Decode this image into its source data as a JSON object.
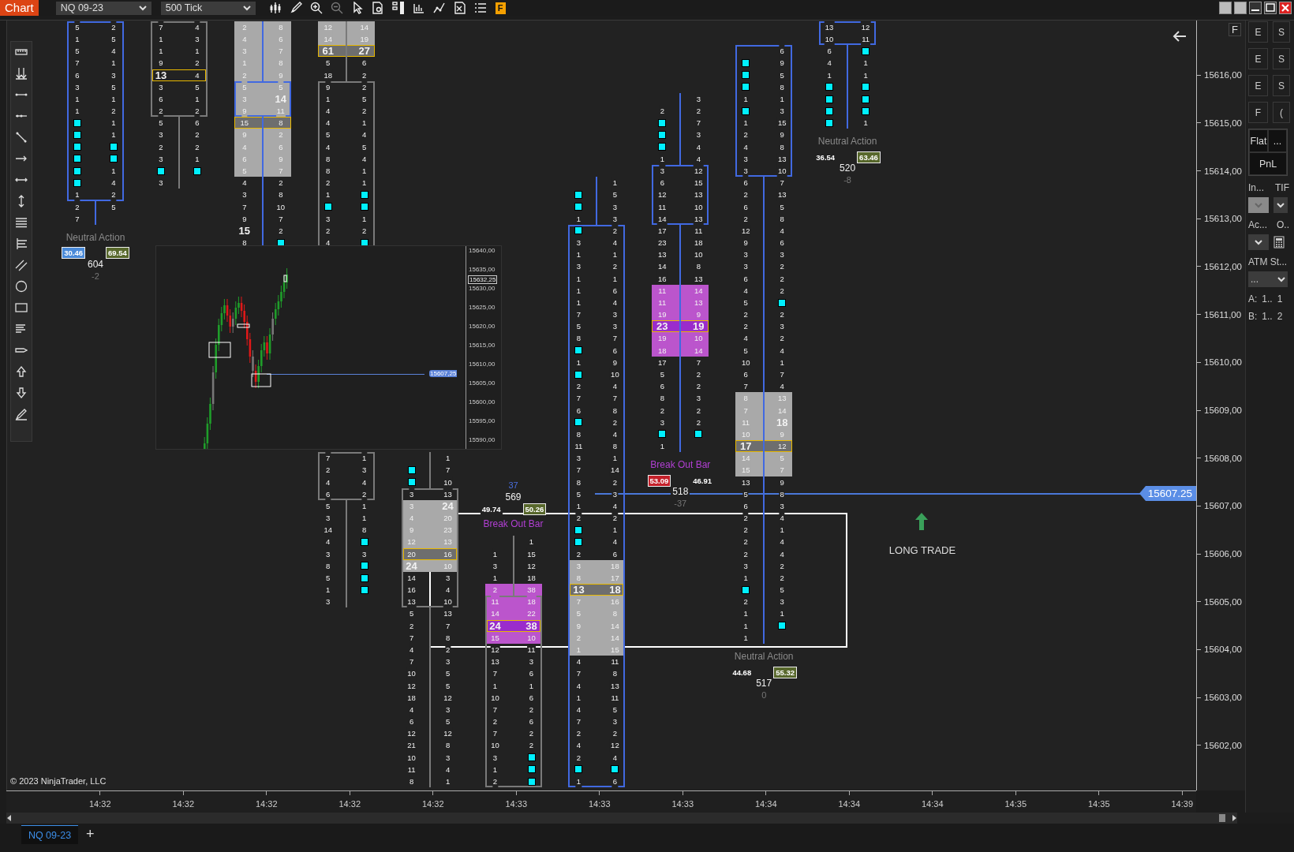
{
  "toolbar": {
    "title": "Chart",
    "instrument": "NQ 09-23",
    "interval": "500 Tick",
    "f_button": "F"
  },
  "chart": {
    "bars": [
      {
        "rising": true,
        "rows": [
          {
            "cells": [
              "5",
              "2"
            ],
            "boxed": true
          },
          {
            "cells": [
              "1",
              "5"
            ],
            "boxed": true
          },
          {
            "cells": [
              "5",
              "4"
            ],
            "boxed": true
          },
          {
            "cells": [
              "7",
              "1"
            ],
            "boxed": true
          },
          {
            "cells": [
              "6",
              "3"
            ],
            "boxed": true
          },
          {
            "cells": [
              "3",
              "5"
            ],
            "boxed": true
          },
          {
            "cells": [
              "1",
              "1"
            ],
            "boxed": true
          },
          {
            "cells": [
              "1",
              "2"
            ],
            "boxed": true
          },
          {
            "cells": [
              {
                "kind": "marker"
              },
              "1"
            ],
            "boxed": true
          },
          {
            "cells": [
              {
                "kind": "marker"
              },
              "1"
            ],
            "boxed": true
          },
          {
            "cells": [
              {
                "kind": "marker"
              },
              {
                "kind": "marker"
              }
            ],
            "boxed": true
          },
          {
            "cells": [
              {
                "kind": "marker"
              },
              {
                "kind": "marker"
              }
            ],
            "boxed": true
          },
          {
            "cells": [
              {
                "kind": "marker"
              },
              "1"
            ],
            "boxed": true
          },
          {
            "cells": [
              {
                "kind": "marker"
              },
              "4"
            ],
            "boxed": true
          },
          {
            "cells": [
              "1",
              "2"
            ],
            "boxed": true
          },
          [
            "2",
            "5"
          ],
          [
            "7",
            null
          ]
        ],
        "summary": {
          "above": false,
          "label": {
            "text": "Neutral Action",
            "breakout": false
          },
          "sell": {
            "text": "30.46",
            "color": "#4a8ad8"
          },
          "buy": {
            "text": "69.54",
            "color": "#58682c"
          },
          "volume": "604",
          "delta": {
            "text": "-2",
            "positive": false
          }
        }
      },
      {
        "rising": false,
        "rows": [
          {
            "cells": [
              "7",
              "4"
            ],
            "boxed": true
          },
          {
            "cells": [
              "1",
              "3"
            ],
            "boxed": true
          },
          {
            "cells": [
              "1",
              "1"
            ],
            "boxed": true
          },
          {
            "cells": [
              "9",
              "2"
            ],
            "boxed": true
          },
          {
            "cells": [
              {
                "text": "13",
                "bold": true
              },
              "4"
            ],
            "boxed": true,
            "gold": true
          },
          {
            "cells": [
              "3",
              "5"
            ],
            "boxed": true
          },
          {
            "cells": [
              "6",
              "1"
            ],
            "boxed": true
          },
          {
            "cells": [
              "2",
              "2"
            ],
            "boxed": true
          },
          [
            "5",
            "6"
          ],
          [
            "3",
            "2"
          ],
          [
            "2",
            "2"
          ],
          [
            "3",
            "1"
          ],
          [
            {
              "kind": "marker"
            },
            {
              "kind": "marker"
            }
          ],
          [
            "3",
            null
          ]
        ]
      },
      {
        "rising": true,
        "rows": [
          {
            "cells": [
              "2",
              "8"
            ],
            "color": "#a9a9a9"
          },
          {
            "cells": [
              "4",
              "6"
            ],
            "color": "#a9a9a9"
          },
          {
            "cells": [
              "3",
              "7"
            ],
            "color": "#a9a9a9"
          },
          {
            "cells": [
              "1",
              "8"
            ],
            "color": "#a9a9a9"
          },
          {
            "cells": [
              "2",
              "9"
            ],
            "color": "#a9a9a9"
          },
          {
            "cells": [
              "5",
              "5"
            ],
            "color": "#a9a9a9",
            "boxed": true
          },
          {
            "cells": [
              "3",
              {
                "text": "14",
                "bold": true
              }
            ],
            "color": "#a9a9a9",
            "boxed": true
          },
          {
            "cells": [
              "9",
              "11"
            ],
            "color": "#a9a9a9",
            "boxed": true
          },
          {
            "cells": [
              "15",
              "8"
            ],
            "color": "#6e6e6e",
            "gold": true
          },
          {
            "cells": [
              "9",
              "2"
            ],
            "color": "#a9a9a9"
          },
          {
            "cells": [
              "4",
              "6"
            ],
            "color": "#a9a9a9"
          },
          {
            "cells": [
              "6",
              "9"
            ],
            "color": "#a9a9a9"
          },
          {
            "cells": [
              "5",
              "7"
            ],
            "color": "#a9a9a9"
          },
          [
            "4",
            "2"
          ],
          [
            "3",
            "8"
          ],
          [
            "7",
            "10"
          ],
          [
            "9",
            "7"
          ],
          [
            {
              "text": "15",
              "bold": true
            },
            "2"
          ],
          [
            "8",
            {
              "kind": "marker"
            }
          ]
        ]
      },
      {
        "rising": false,
        "rows": [
          {
            "cells": [
              "12",
              "14"
            ],
            "color": "#a9a9a9"
          },
          {
            "cells": [
              "14",
              "19"
            ],
            "color": "#a9a9a9"
          },
          {
            "cells": [
              {
                "text": "61",
                "bold": true
              },
              {
                "text": "27",
                "bold": true
              }
            ],
            "color": "#6e6e6e",
            "gold": true
          },
          [
            "5",
            "6"
          ],
          [
            "18",
            "2"
          ],
          {
            "cells": [
              "9",
              "2"
            ],
            "boxed": true
          },
          {
            "cells": [
              "1",
              "5"
            ],
            "boxed": true
          },
          {
            "cells": [
              "4",
              "2"
            ],
            "boxed": true
          },
          {
            "cells": [
              "4",
              "1"
            ],
            "boxed": true
          },
          {
            "cells": [
              "5",
              "4"
            ],
            "boxed": true
          },
          {
            "cells": [
              "4",
              "5"
            ],
            "boxed": true
          },
          {
            "cells": [
              "8",
              "4"
            ],
            "boxed": true
          },
          {
            "cells": [
              "8",
              "1"
            ],
            "boxed": true
          },
          {
            "cells": [
              "2",
              "1"
            ],
            "boxed": true
          },
          {
            "cells": [
              "1",
              {
                "kind": "marker"
              }
            ],
            "boxed": true
          },
          {
            "cells": [
              {
                "kind": "marker"
              },
              {
                "kind": "marker"
              }
            ],
            "boxed": true
          },
          {
            "cells": [
              "3",
              "1"
            ],
            "boxed": true
          },
          {
            "cells": [
              "2",
              "2"
            ],
            "boxed": true
          },
          {
            "cells": [
              "4",
              {
                "kind": "marker"
              }
            ],
            "boxed": true
          },
          null,
          null,
          null,
          null,
          null,
          null,
          null,
          null,
          null,
          null,
          null,
          null,
          null,
          null,
          null,
          null,
          null,
          {
            "cells": [
              "7",
              "1"
            ],
            "boxed": true
          },
          {
            "cells": [
              "2",
              "3"
            ],
            "boxed": true
          },
          {
            "cells": [
              "4",
              "4"
            ],
            "boxed": true
          },
          {
            "cells": [
              "6",
              "2"
            ],
            "boxed": true
          },
          [
            "5",
            "1"
          ],
          [
            "3",
            "1"
          ],
          [
            "14",
            "8"
          ],
          [
            "4",
            {
              "kind": "marker"
            }
          ],
          [
            "3",
            "3"
          ],
          [
            "8",
            {
              "kind": "marker"
            }
          ],
          [
            "5",
            {
              "kind": "marker"
            }
          ],
          [
            "1",
            {
              "kind": "marker"
            }
          ],
          [
            "3",
            null
          ]
        ]
      },
      {
        "rising": false,
        "rows": [
          null,
          null,
          null,
          null,
          null,
          null,
          null,
          null,
          null,
          null,
          null,
          null,
          null,
          null,
          null,
          null,
          null,
          null,
          null,
          null,
          null,
          null,
          null,
          null,
          null,
          null,
          null,
          null,
          null,
          null,
          null,
          null,
          null,
          null,
          null,
          null,
          [
            null,
            "1"
          ],
          [
            {
              "kind": "marker"
            },
            "7"
          ],
          [
            {
              "kind": "marker"
            },
            "10"
          ],
          {
            "cells": [
              "3",
              "13"
            ],
            "boxed": true
          },
          {
            "cells": [
              "3",
              {
                "text": "24",
                "bold": true
              }
            ],
            "boxed": true,
            "color": "#a9a9a9"
          },
          {
            "cells": [
              "4",
              "20"
            ],
            "boxed": true,
            "color": "#a9a9a9"
          },
          {
            "cells": [
              "9",
              "23"
            ],
            "boxed": true,
            "color": "#a9a9a9"
          },
          {
            "cells": [
              "12",
              "13"
            ],
            "boxed": true,
            "color": "#a9a9a9"
          },
          {
            "cells": [
              "20",
              "16"
            ],
            "boxed": true,
            "color": "#6e6e6e",
            "gold": true
          },
          {
            "cells": [
              {
                "text": "24",
                "bold": true
              },
              "10"
            ],
            "boxed": true,
            "color": "#a9a9a9"
          },
          {
            "cells": [
              "14",
              "3"
            ],
            "boxed": true
          },
          {
            "cells": [
              "16",
              "4"
            ],
            "boxed": true
          },
          {
            "cells": [
              "13",
              "10"
            ],
            "boxed": true
          },
          [
            "5",
            "13"
          ],
          [
            "2",
            "7"
          ],
          [
            "7",
            "8"
          ],
          [
            "4",
            "2"
          ],
          [
            "7",
            "3"
          ],
          [
            "10",
            "5"
          ],
          [
            "12",
            "5"
          ],
          [
            "18",
            "12"
          ],
          [
            "4",
            "3"
          ],
          [
            "6",
            "5"
          ],
          [
            "12",
            "12"
          ],
          [
            "21",
            "8"
          ],
          [
            "10",
            "3"
          ],
          [
            "11",
            "4"
          ],
          [
            "8",
            "1"
          ]
        ]
      },
      {
        "rising": false,
        "rows": [
          null,
          null,
          null,
          null,
          null,
          null,
          null,
          null,
          null,
          null,
          null,
          null,
          null,
          null,
          null,
          null,
          null,
          null,
          null,
          null,
          null,
          null,
          null,
          null,
          null,
          null,
          null,
          null,
          null,
          null,
          null,
          null,
          null,
          null,
          null,
          null,
          null,
          null,
          null,
          null,
          null,
          null,
          null,
          [
            null,
            "1"
          ],
          [
            "1",
            "15"
          ],
          [
            "3",
            "12"
          ],
          [
            "1",
            "18"
          ],
          {
            "cells": [
              "2",
              "38"
            ],
            "color": "#bb55cc"
          },
          {
            "cells": [
              "11",
              "18"
            ],
            "color": "#bb55cc",
            "boxed": true
          },
          {
            "cells": [
              "14",
              "22"
            ],
            "color": "#bb55cc",
            "boxed": true
          },
          {
            "cells": [
              {
                "text": "24",
                "bold": true
              },
              {
                "text": "38",
                "bold": true
              }
            ],
            "color": "#9a2ccc",
            "boxed": true,
            "gold": true
          },
          {
            "cells": [
              "15",
              "10"
            ],
            "color": "#bb55cc",
            "boxed": true
          },
          {
            "cells": [
              "12",
              "11"
            ],
            "boxed": true
          },
          {
            "cells": [
              "13",
              "3"
            ],
            "boxed": true
          },
          {
            "cells": [
              "7",
              "6"
            ],
            "boxed": true
          },
          {
            "cells": [
              "1",
              "1"
            ],
            "boxed": true
          },
          {
            "cells": [
              "10",
              "6"
            ],
            "boxed": true
          },
          {
            "cells": [
              "7",
              "2"
            ],
            "boxed": true
          },
          {
            "cells": [
              "2",
              "6"
            ],
            "boxed": true
          },
          {
            "cells": [
              "7",
              "2"
            ],
            "boxed": true
          },
          {
            "cells": [
              "10",
              "2"
            ],
            "boxed": true
          },
          {
            "cells": [
              "3",
              {
                "kind": "marker"
              }
            ],
            "boxed": true
          },
          {
            "cells": [
              "1",
              {
                "kind": "marker"
              }
            ],
            "boxed": true
          },
          {
            "cells": [
              "2",
              {
                "kind": "marker"
              }
            ],
            "boxed": true
          }
        ],
        "summary": {
          "above": true,
          "label": {
            "text": "Break Out Bar",
            "breakout": true
          },
          "sell": {
            "text": "49.74"
          },
          "buy": {
            "text": "50.26",
            "color": "#58682c"
          },
          "volume": "569",
          "delta": {
            "text": "37",
            "positive": true
          }
        }
      },
      {
        "rising": true,
        "rows": [
          null,
          null,
          null,
          null,
          null,
          null,
          null,
          null,
          null,
          null,
          null,
          null,
          null,
          [
            null,
            "1"
          ],
          [
            {
              "kind": "marker"
            },
            "5"
          ],
          [
            {
              "kind": "marker"
            },
            "3"
          ],
          [
            "1",
            "3"
          ],
          {
            "cells": [
              {
                "kind": "marker"
              },
              "2"
            ],
            "boxed": true
          },
          {
            "cells": [
              "3",
              "4"
            ],
            "boxed": true
          },
          {
            "cells": [
              "1",
              "1"
            ],
            "boxed": true
          },
          {
            "cells": [
              "3",
              "2"
            ],
            "boxed": true
          },
          {
            "cells": [
              "1",
              "1"
            ],
            "boxed": true
          },
          {
            "cells": [
              "1",
              "6"
            ],
            "boxed": true
          },
          {
            "cells": [
              "1",
              "4"
            ],
            "boxed": true
          },
          {
            "cells": [
              "7",
              "3"
            ],
            "boxed": true
          },
          {
            "cells": [
              "5",
              "3"
            ],
            "boxed": true
          },
          {
            "cells": [
              "8",
              "7"
            ],
            "boxed": true
          },
          {
            "cells": [
              {
                "kind": "marker"
              },
              "6"
            ],
            "boxed": true
          },
          {
            "cells": [
              "1",
              "9"
            ],
            "boxed": true
          },
          {
            "cells": [
              {
                "kind": "marker"
              },
              "10"
            ],
            "boxed": true
          },
          {
            "cells": [
              "2",
              "4"
            ],
            "boxed": true
          },
          {
            "cells": [
              "7",
              "7"
            ],
            "boxed": true
          },
          {
            "cells": [
              "6",
              "8"
            ],
            "boxed": true
          },
          {
            "cells": [
              {
                "kind": "marker"
              },
              "2"
            ],
            "boxed": true
          },
          {
            "cells": [
              "8",
              "4"
            ],
            "boxed": true
          },
          {
            "cells": [
              "11",
              "8"
            ],
            "boxed": true
          },
          {
            "cells": [
              "3",
              "1"
            ],
            "boxed": true
          },
          {
            "cells": [
              "7",
              "14"
            ],
            "boxed": true
          },
          {
            "cells": [
              "8",
              "2"
            ],
            "boxed": true
          },
          {
            "cells": [
              "5",
              "3"
            ],
            "boxed": true
          },
          {
            "cells": [
              "1",
              "4"
            ],
            "boxed": true
          },
          {
            "cells": [
              "2",
              "2"
            ],
            "boxed": true
          },
          {
            "cells": [
              {
                "kind": "marker"
              },
              "1"
            ],
            "boxed": true
          },
          {
            "cells": [
              {
                "kind": "marker"
              },
              "4"
            ],
            "boxed": true
          },
          {
            "cells": [
              "2",
              "6"
            ],
            "boxed": true
          },
          {
            "cells": [
              "3",
              "18"
            ],
            "boxed": true,
            "color": "#a9a9a9"
          },
          {
            "cells": [
              "8",
              "17"
            ],
            "boxed": true,
            "color": "#a9a9a9"
          },
          {
            "cells": [
              {
                "text": "13",
                "bold": true
              },
              {
                "text": "18",
                "bold": true
              }
            ],
            "boxed": true,
            "color": "#6e6e6e",
            "gold": true
          },
          {
            "cells": [
              "7",
              "16"
            ],
            "boxed": true,
            "color": "#a9a9a9"
          },
          {
            "cells": [
              "5",
              "8"
            ],
            "boxed": true,
            "color": "#a9a9a9"
          },
          {
            "cells": [
              "9",
              "14"
            ],
            "boxed": true,
            "color": "#a9a9a9"
          },
          {
            "cells": [
              "2",
              "14"
            ],
            "boxed": true,
            "color": "#a9a9a9"
          },
          {
            "cells": [
              "1",
              "15"
            ],
            "boxed": true,
            "color": "#a9a9a9"
          },
          {
            "cells": [
              "4",
              "11"
            ],
            "boxed": true
          },
          {
            "cells": [
              "7",
              "8"
            ],
            "boxed": true
          },
          {
            "cells": [
              "4",
              "13"
            ],
            "boxed": true
          },
          {
            "cells": [
              "1",
              "11"
            ],
            "boxed": true
          },
          {
            "cells": [
              "4",
              "5"
            ],
            "boxed": true
          },
          {
            "cells": [
              "7",
              "3"
            ],
            "boxed": true
          },
          {
            "cells": [
              "2",
              "2"
            ],
            "boxed": true
          },
          {
            "cells": [
              "4",
              "12"
            ],
            "boxed": true
          },
          {
            "cells": [
              "2",
              "4"
            ],
            "boxed": true
          },
          {
            "cells": [
              {
                "kind": "marker"
              },
              {
                "kind": "marker"
              }
            ],
            "boxed": true
          },
          {
            "cells": [
              "1",
              "6"
            ],
            "boxed": true
          }
        ]
      },
      {
        "rising": true,
        "rows": [
          null,
          null,
          null,
          null,
          null,
          null,
          [
            null,
            "3"
          ],
          [
            "2",
            "2"
          ],
          [
            {
              "kind": "marker"
            },
            "7"
          ],
          [
            {
              "kind": "marker"
            },
            "3"
          ],
          [
            {
              "kind": "marker"
            },
            "4"
          ],
          [
            "1",
            "4"
          ],
          {
            "cells": [
              "3",
              "12"
            ],
            "boxed": true
          },
          {
            "cells": [
              "6",
              "15"
            ],
            "boxed": true
          },
          {
            "cells": [
              "12",
              "13"
            ],
            "boxed": true
          },
          {
            "cells": [
              "11",
              "10"
            ],
            "boxed": true
          },
          {
            "cells": [
              "14",
              "13"
            ],
            "boxed": true
          },
          [
            "17",
            "11"
          ],
          [
            "23",
            "18"
          ],
          [
            "13",
            "10"
          ],
          [
            "14",
            "8"
          ],
          [
            "16",
            "13"
          ],
          {
            "cells": [
              "11",
              "14"
            ],
            "color": "#bb55cc"
          },
          {
            "cells": [
              "11",
              "13"
            ],
            "color": "#bb55cc"
          },
          {
            "cells": [
              "19",
              "9"
            ],
            "color": "#bb55cc"
          },
          {
            "cells": [
              {
                "text": "23",
                "bold": true
              },
              {
                "text": "19",
                "bold": true
              }
            ],
            "color": "#9a2ccc",
            "gold": true
          },
          {
            "cells": [
              "19",
              "10"
            ],
            "color": "#bb55cc"
          },
          {
            "cells": [
              "18",
              "14"
            ],
            "color": "#bb55cc"
          },
          [
            "17",
            "7"
          ],
          [
            "5",
            "2"
          ],
          [
            "6",
            "2"
          ],
          [
            "8",
            "3"
          ],
          [
            "2",
            "2"
          ],
          [
            "3",
            "2"
          ],
          [
            {
              "kind": "marker"
            },
            {
              "kind": "marker"
            }
          ],
          [
            "1",
            null
          ]
        ],
        "summary": {
          "above": false,
          "label": {
            "text": "Break Out Bar",
            "breakout": true
          },
          "sell": {
            "text": "53.09",
            "color": "#c4202a"
          },
          "buy": {
            "text": "46.91"
          },
          "volume": "518",
          "delta": {
            "text": "-37",
            "positive": false
          }
        }
      },
      {
        "rising": true,
        "rows": [
          null,
          null,
          {
            "cells": [
              null,
              "6"
            ],
            "boxed": true
          },
          {
            "cells": [
              {
                "kind": "marker"
              },
              "9"
            ],
            "boxed": true
          },
          {
            "cells": [
              {
                "kind": "marker"
              },
              "5"
            ],
            "boxed": true
          },
          {
            "cells": [
              {
                "kind": "marker"
              },
              "8"
            ],
            "boxed": true
          },
          {
            "cells": [
              "1",
              "1"
            ],
            "boxed": true
          },
          {
            "cells": [
              {
                "kind": "marker"
              },
              "3"
            ],
            "boxed": true
          },
          {
            "cells": [
              "1",
              "15"
            ],
            "boxed": true
          },
          {
            "cells": [
              "2",
              "9"
            ],
            "boxed": true
          },
          {
            "cells": [
              "4",
              "8"
            ],
            "boxed": true
          },
          {
            "cells": [
              "3",
              "13"
            ],
            "boxed": true
          },
          {
            "cells": [
              "3",
              "10"
            ],
            "boxed": true
          },
          [
            "6",
            "7"
          ],
          [
            "2",
            "13"
          ],
          [
            "6",
            "5"
          ],
          [
            "2",
            "8"
          ],
          [
            "12",
            "4"
          ],
          [
            "9",
            "6"
          ],
          [
            "3",
            "3"
          ],
          [
            "3",
            "2"
          ],
          [
            "6",
            "2"
          ],
          [
            "4",
            "2"
          ],
          [
            "5",
            {
              "kind": "marker"
            }
          ],
          [
            "2",
            "2"
          ],
          [
            "2",
            "3"
          ],
          [
            "4",
            "2"
          ],
          [
            "5",
            "4"
          ],
          [
            "10",
            "1"
          ],
          [
            "6",
            "7"
          ],
          [
            "7",
            "4"
          ],
          {
            "cells": [
              "8",
              "13"
            ],
            "color": "#a9a9a9"
          },
          {
            "cells": [
              "7",
              "14"
            ],
            "color": "#a9a9a9"
          },
          {
            "cells": [
              "11",
              {
                "text": "18",
                "bold": true
              }
            ],
            "color": "#a9a9a9"
          },
          {
            "cells": [
              "10",
              "9"
            ],
            "color": "#a9a9a9"
          },
          {
            "cells": [
              {
                "text": "17",
                "bold": true
              },
              "12"
            ],
            "color": "#6e6e6e",
            "gold": true
          },
          {
            "cells": [
              "14",
              "5"
            ],
            "color": "#a9a9a9"
          },
          {
            "cells": [
              "15",
              "7"
            ],
            "color": "#a9a9a9"
          },
          [
            "13",
            "9"
          ],
          [
            "5",
            "8"
          ],
          [
            "6",
            "3"
          ],
          [
            "2",
            "4"
          ],
          [
            "2",
            "1"
          ],
          [
            "2",
            "4"
          ],
          [
            "2",
            "4"
          ],
          [
            "3",
            "2"
          ],
          [
            "1",
            "2"
          ],
          [
            {
              "kind": "marker"
            },
            "5"
          ],
          [
            "2",
            "3"
          ],
          [
            "1",
            "1"
          ],
          [
            "1",
            {
              "kind": "marker"
            }
          ],
          [
            "1",
            null
          ]
        ],
        "summary": {
          "above": false,
          "label": {
            "text": "Neutral Action",
            "breakout": false
          },
          "sell": {
            "text": "44.68"
          },
          "buy": {
            "text": "55.32",
            "color": "#58682c"
          },
          "volume": "517",
          "delta": {
            "text": "0",
            "positive": false
          }
        }
      },
      {
        "rising": true,
        "rows": [
          {
            "cells": [
              "13",
              "12"
            ],
            "boxed": true
          },
          {
            "cells": [
              "10",
              "11"
            ],
            "boxed": true
          },
          [
            "6",
            {
              "kind": "marker"
            }
          ],
          [
            "4",
            "1"
          ],
          [
            "1",
            "1"
          ],
          [
            {
              "kind": "marker"
            },
            {
              "kind": "marker"
            }
          ],
          [
            {
              "kind": "marker"
            },
            {
              "kind": "marker"
            }
          ],
          [
            {
              "kind": "marker"
            },
            {
              "kind": "marker"
            }
          ],
          [
            {
              "kind": "marker"
            },
            "1"
          ]
        ],
        "summary": {
          "above": false,
          "label": {
            "text": "Neutral Action",
            "breakout": false
          },
          "sell": {
            "text": "36.54"
          },
          "buy": {
            "text": "63.46",
            "color": "#58682c"
          },
          "volume": "520",
          "delta": {
            "text": "-8",
            "positive": false
          }
        }
      }
    ],
    "inset": {
      "axis_labels": [
        "15640,00",
        "15635,00",
        "15630,00",
        "15625,00",
        "15620,00",
        "15615,00",
        "15610,00",
        "15605,00",
        "15600,00",
        "15595,00",
        "15590,00"
      ],
      "high_tag": "15632,25",
      "price_tag": "15607,25"
    },
    "price_tag": "15607.25",
    "trade_label": "LONG TRADE",
    "copyright": "© 2023 NinjaTrader, LLC"
  },
  "price_axis": {
    "f_button": "F",
    "labels": [
      "15616,00",
      "15615,00",
      "15614,00",
      "15613,00",
      "15612,00",
      "15611,00",
      "15610,00",
      "15609,00",
      "15608,00",
      "15607,00",
      "15606,00",
      "15605,00",
      "15604,00",
      "15603,00",
      "15602,00"
    ]
  },
  "time_axis": [
    "14:32",
    "14:32",
    "14:32",
    "14:32",
    "14:32",
    "14:33",
    "14:33",
    "14:33",
    "14:34",
    "14:34",
    "14:34",
    "14:35",
    "14:35",
    "14:39"
  ],
  "side_panel": {
    "order_buttons": [
      {
        "label": "E"
      },
      {
        "label": "S"
      },
      {
        "label": "E"
      },
      {
        "label": "S"
      },
      {
        "label": "E"
      },
      {
        "label": "S"
      },
      {
        "label": "F"
      },
      {
        "label": "("
      }
    ],
    "position": "Flat",
    "position_menu": "...",
    "pnl": "PnL",
    "instrument_label": "In...",
    "tif_label": "TIF",
    "instrument_select": {
      "disabled": true
    },
    "account_label": "Ac...",
    "order_label": "O..",
    "atm_label": "ATM St...",
    "atm_select": "...",
    "quantities": [
      {
        "label": "A:",
        "value": "1..",
        "count": "1"
      },
      {
        "label": "B:",
        "value": "1..",
        "count": "2"
      }
    ]
  },
  "tabs": [
    {
      "label": "NQ 09-23",
      "selected": true
    }
  ],
  "add_tab": "+"
}
